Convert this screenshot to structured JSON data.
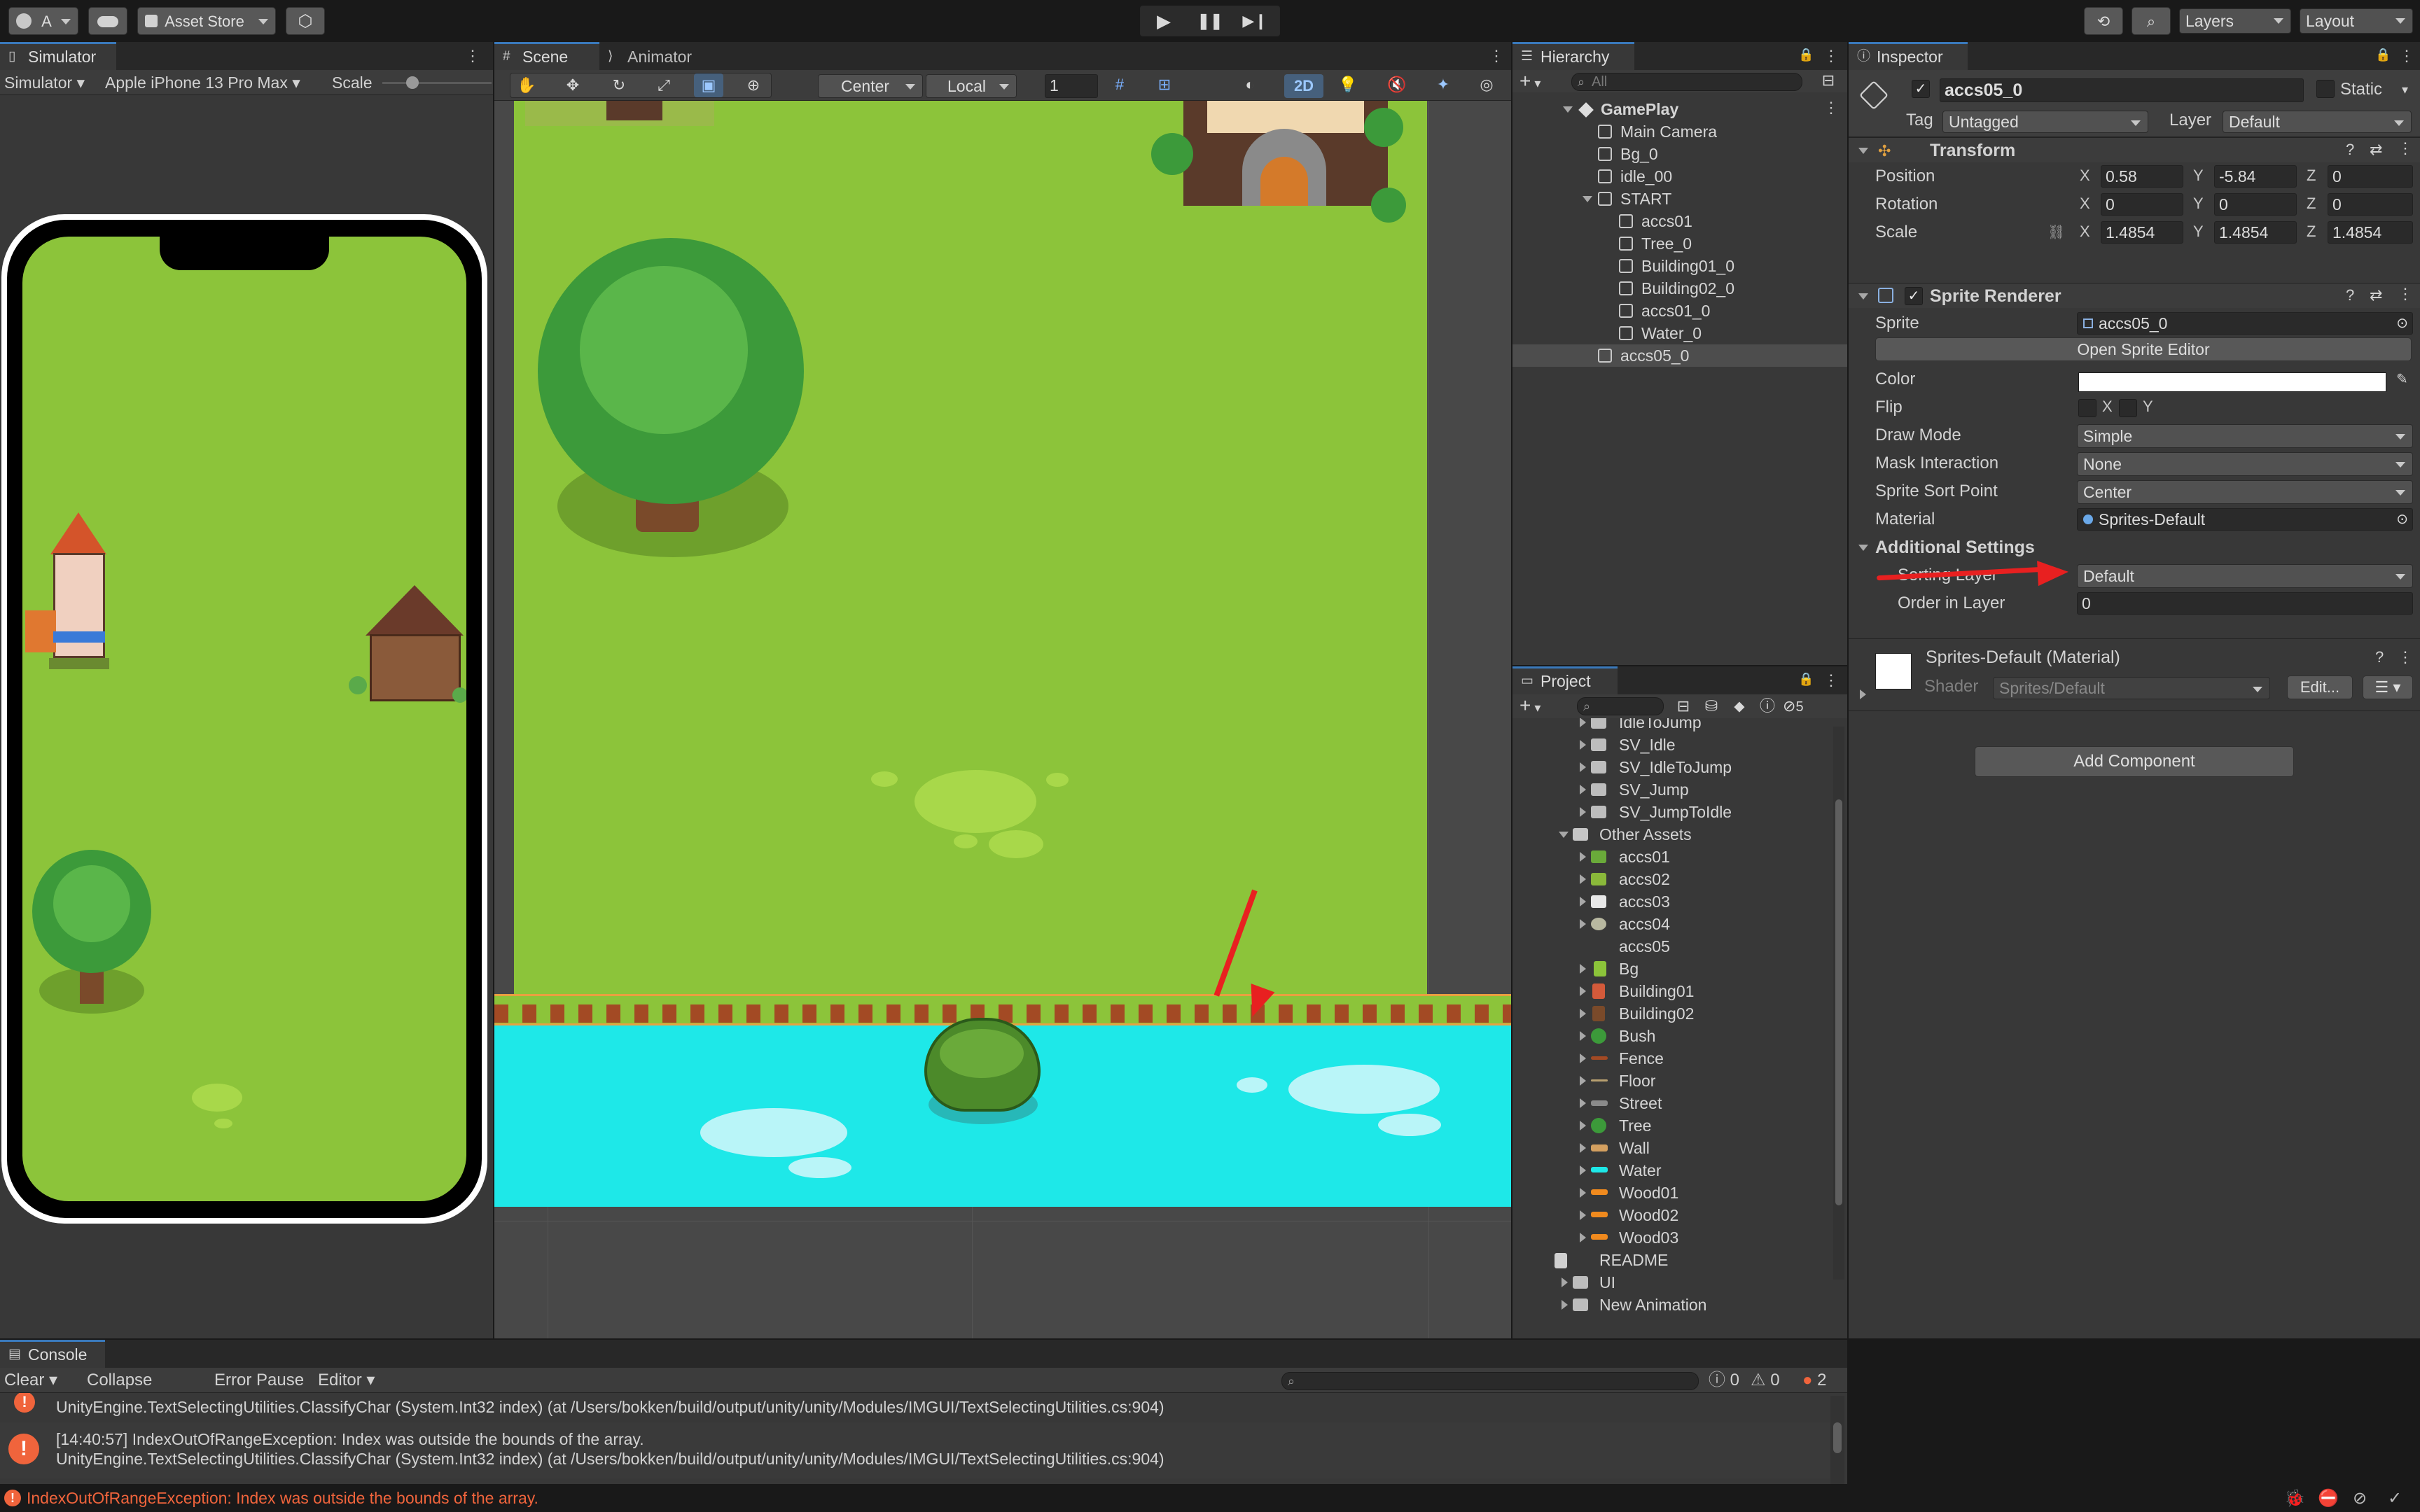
{
  "toolbar": {
    "account": "A",
    "asset_store": "Asset Store",
    "layers": "Layers",
    "layout": "Layout"
  },
  "simulator": {
    "tab": "Simulator",
    "mode": "Simulator",
    "device": "Apple iPhone 13 Pro Max",
    "scale_label": "Scale"
  },
  "scene": {
    "tab_scene": "Scene",
    "tab_animator": "Animator",
    "pivot": "Center",
    "space": "Local",
    "grid_value": "1",
    "mode_2d": "2D",
    "hidden_count": "5"
  },
  "hierarchy": {
    "tab": "Hierarchy",
    "search_placeholder": "All",
    "items": [
      {
        "label": "GamePlay"
      },
      {
        "label": "Main Camera"
      },
      {
        "label": "Bg_0"
      },
      {
        "label": "idle_00"
      },
      {
        "label": "START"
      },
      {
        "label": "accs01"
      },
      {
        "label": "Tree_0"
      },
      {
        "label": "Building01_0"
      },
      {
        "label": "Building02_0"
      },
      {
        "label": "accs01_0"
      },
      {
        "label": "Water_0"
      },
      {
        "label": "accs05_0"
      }
    ]
  },
  "project": {
    "tab": "Project",
    "items": [
      {
        "label": "IdleToJump"
      },
      {
        "label": "SV_Idle"
      },
      {
        "label": "SV_IdleToJump"
      },
      {
        "label": "SV_Jump"
      },
      {
        "label": "SV_JumpToIdle"
      },
      {
        "label": "Other Assets"
      },
      {
        "label": "accs01"
      },
      {
        "label": "accs02"
      },
      {
        "label": "accs03"
      },
      {
        "label": "accs04"
      },
      {
        "label": "accs05"
      },
      {
        "label": "Bg"
      },
      {
        "label": "Building01"
      },
      {
        "label": "Building02"
      },
      {
        "label": "Bush"
      },
      {
        "label": "Fence"
      },
      {
        "label": "Floor"
      },
      {
        "label": "Street"
      },
      {
        "label": "Tree"
      },
      {
        "label": "Wall"
      },
      {
        "label": "Water"
      },
      {
        "label": "Wood01"
      },
      {
        "label": "Wood02"
      },
      {
        "label": "Wood03"
      },
      {
        "label": "README"
      },
      {
        "label": "UI"
      },
      {
        "label": "New Animation"
      }
    ]
  },
  "inspector": {
    "tab": "Inspector",
    "object_name": "accs05_0",
    "static_label": "Static",
    "tag_label": "Tag",
    "tag_value": "Untagged",
    "layer_label": "Layer",
    "layer_value": "Default",
    "transform": {
      "title": "Transform",
      "position_label": "Position",
      "rotation_label": "Rotation",
      "scale_label": "Scale",
      "position": {
        "x": "0.58",
        "y": "-5.84",
        "z": "0"
      },
      "rotation": {
        "x": "0",
        "y": "0",
        "z": "0"
      },
      "scale": {
        "x": "1.4854",
        "y": "1.4854",
        "z": "1.4854"
      },
      "x": "X",
      "y": "Y",
      "z": "Z"
    },
    "sprite_renderer": {
      "title": "Sprite Renderer",
      "sprite_label": "Sprite",
      "sprite_value": "accs05_0",
      "open_editor": "Open Sprite Editor",
      "color_label": "Color",
      "flip_label": "Flip",
      "flip_x": "X",
      "flip_y": "Y",
      "draw_mode_label": "Draw Mode",
      "draw_mode": "Simple",
      "mask_label": "Mask Interaction",
      "mask": "None",
      "sort_point_label": "Sprite Sort Point",
      "sort_point": "Center",
      "material_label": "Material",
      "material": "Sprites-Default",
      "additional_settings": "Additional Settings",
      "sorting_layer_label": "Sorting Layer",
      "sorting_layer": "Default",
      "order_label": "Order in Layer",
      "order": "0"
    },
    "material": {
      "title": "Sprites-Default (Material)",
      "shader_label": "Shader",
      "shader": "Sprites/Default",
      "edit": "Edit..."
    },
    "add_component": "Add Component"
  },
  "console": {
    "tab": "Console",
    "clear": "Clear",
    "collapse": "Collapse",
    "error_pause": "Error Pause",
    "editor": "Editor",
    "count_log": "0",
    "count_warn": "0",
    "count_err": "2",
    "line0": "UnityEngine.TextSelectingUtilities.ClassifyChar (System.Int32 index) (at /Users/bokken/build/output/unity/unity/Modules/IMGUI/TextSelectingUtilities.cs:904)",
    "line1": "[14:40:57] IndexOutOfRangeException: Index was outside the bounds of the array.",
    "line2": "UnityEngine.TextSelectingUtilities.ClassifyChar (System.Int32 index) (at /Users/bokken/build/output/unity/unity/Modules/IMGUI/TextSelectingUtilities.cs:904)"
  },
  "status": {
    "message": "IndexOutOfRangeException: Index was outside the bounds of the array."
  },
  "colors": {
    "accent": "#3a79bb",
    "grass": "#8cc43a",
    "water": "#1ee8e8",
    "error": "#f0643c",
    "arrow": "#e82020"
  }
}
